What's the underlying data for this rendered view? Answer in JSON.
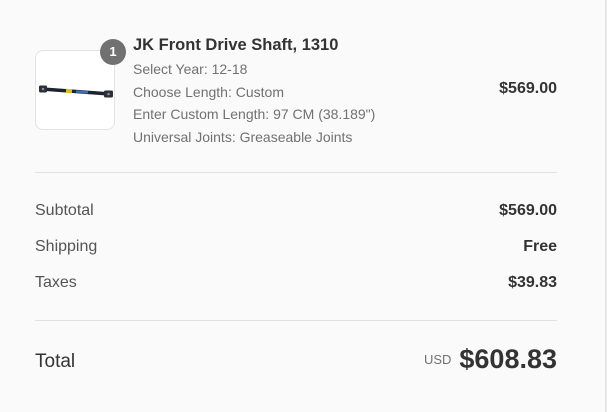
{
  "line_item": {
    "quantity": "1",
    "title": "JK Front Drive Shaft, 1310",
    "options": [
      "Select Year: 12-18",
      "Choose Length: Custom",
      "Enter Custom Length: 97 CM (38.189\")",
      "Universal Joints: Greaseable Joints"
    ],
    "price": "$569.00",
    "image_icon": "drive-shaft-image"
  },
  "summary": {
    "subtotal_label": "Subtotal",
    "subtotal_value": "$569.00",
    "shipping_label": "Shipping",
    "shipping_value": "Free",
    "taxes_label": "Taxes",
    "taxes_value": "$39.83"
  },
  "total": {
    "label": "Total",
    "currency": "USD",
    "amount": "$608.83"
  },
  "colors": {
    "background": "#fafafa",
    "badge": "#717171",
    "text_primary": "#333333",
    "text_secondary": "#717171"
  }
}
